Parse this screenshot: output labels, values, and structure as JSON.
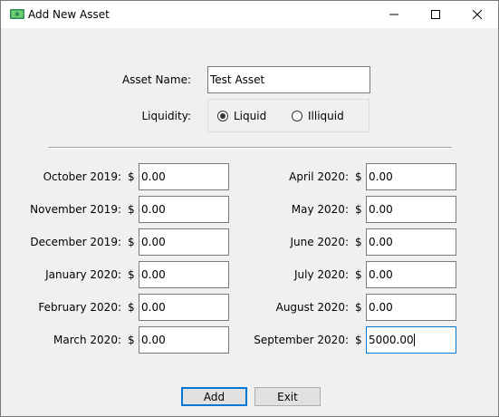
{
  "window": {
    "title": "Add New Asset",
    "icon": "money-icon",
    "controls": [
      "minimize-icon",
      "maximize-icon",
      "close-icon"
    ]
  },
  "form": {
    "asset_name_label": "Asset Name:",
    "asset_name_value": "Test Asset",
    "liquidity_label": "Liquidity:",
    "liquidity_options": [
      {
        "label": "Liquid",
        "selected": true
      },
      {
        "label": "Illiquid",
        "selected": false
      }
    ],
    "currency_symbol": "$",
    "months_left": [
      {
        "label": "October 2019:",
        "value": "0.00"
      },
      {
        "label": "November 2019:",
        "value": "0.00"
      },
      {
        "label": "December 2019:",
        "value": "0.00"
      },
      {
        "label": "January 2020:",
        "value": "0.00"
      },
      {
        "label": "February 2020:",
        "value": "0.00"
      },
      {
        "label": "March 2020:",
        "value": "0.00"
      }
    ],
    "months_right": [
      {
        "label": "April 2020:",
        "value": "0.00"
      },
      {
        "label": "May 2020:",
        "value": "0.00"
      },
      {
        "label": "June 2020:",
        "value": "0.00"
      },
      {
        "label": "July 2020:",
        "value": "0.00"
      },
      {
        "label": "August 2020:",
        "value": "0.00"
      },
      {
        "label": "September 2020:",
        "value": "5000.00"
      }
    ]
  },
  "buttons": {
    "add_label": "Add",
    "exit_label": "Exit"
  },
  "colors": {
    "accent": "#0078d7",
    "window_bg": "#f0f0f0",
    "titlebar_bg": "#ffffff",
    "button_bg": "#e1e1e1"
  }
}
